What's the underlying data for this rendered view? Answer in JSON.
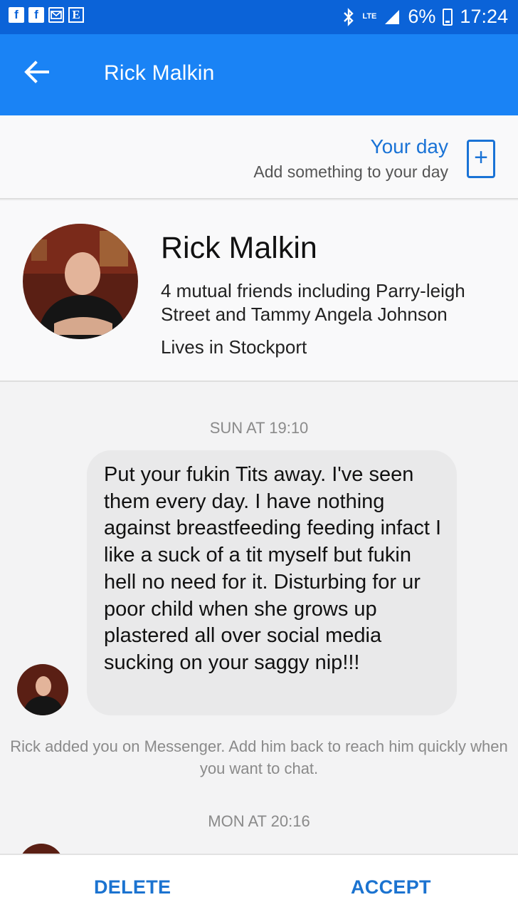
{
  "status_bar": {
    "notification_icons": [
      "facebook-icon",
      "facebook-icon",
      "mail-icon",
      "e-icon"
    ],
    "e_letter": "E",
    "lte": "LTE",
    "battery": "6%",
    "time": "17:24"
  },
  "app_bar": {
    "title": "Rick Malkin",
    "back_icon": "arrow-left-icon"
  },
  "your_day": {
    "title": "Your day",
    "subtitle": "Add something to your day",
    "add_icon": "plus-box-icon",
    "add_symbol": "+"
  },
  "profile": {
    "name": "Rick Malkin",
    "mutual": "4 mutual friends including Parry-leigh Street and Tammy Angela Johnson",
    "lives": "Lives in Stockport"
  },
  "conversation": {
    "timestamp_1": "SUN AT 19:10",
    "message": "Put your fukin Tits away. I've seen them every day. I have nothing against breastfeeding feeding infact I like a suck of a tit myself but fukin hell no need for it. Disturbing for ur poor child when she grows up plastered all over social media sucking on your saggy nip!!!",
    "added_note": "Rick added you on Messenger. Add him back to reach him quickly when you want to chat.",
    "timestamp_2": "MON AT 20:16"
  },
  "actions": {
    "delete": "DELETE",
    "accept": "ACCEPT"
  },
  "colors": {
    "status_bar": "#0b63d8",
    "app_bar": "#1a83f5",
    "accent": "#1a73d6",
    "bubble": "#e9e9ea",
    "background": "#f3f3f4"
  }
}
